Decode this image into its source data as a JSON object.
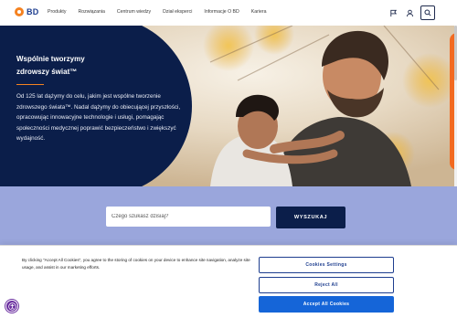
{
  "header": {
    "logo_text": "BD",
    "nav": [
      {
        "label": "Produkty"
      },
      {
        "label": "Rozwiązania"
      },
      {
        "label": "Centrum wiedzy"
      },
      {
        "label": "Dział eksperci"
      },
      {
        "label": "Informacje O BD"
      },
      {
        "label": "Kariera"
      }
    ],
    "icons": [
      "flag-icon",
      "user-icon",
      "search-icon"
    ]
  },
  "hero": {
    "title_line1": "Wspólnie tworzymy",
    "title_line2": "zdrowszy świat™",
    "body": "Od 125 lat dążymy do celu, jakim jest wspólne tworzenie zdrowszego świata™. Nadal dążymy do obiecującej przyszłości, opracowując innowacyjne technologie i usługi, pomagając społeczności medycznej poprawić bezpieczeństwo i zwiększyć wydajność.",
    "colors": {
      "panel": "#0b1e4a",
      "accent": "#f58220"
    }
  },
  "search": {
    "placeholder": "Czego szukasz dzisiaj?",
    "button_label": "WYSZUKAJ"
  },
  "cookie": {
    "text_before": "By clicking \"Accept All Cookies\", you agree to the storing of cookies on your device to enhance site navigation, analyze site usage, and assist in our marketing efforts.",
    "settings_label": "Cookies Settings",
    "reject_label": "Reject All",
    "accept_label": "Accept All Cookies"
  },
  "accessibility": {
    "icon": "accessibility-icon"
  }
}
